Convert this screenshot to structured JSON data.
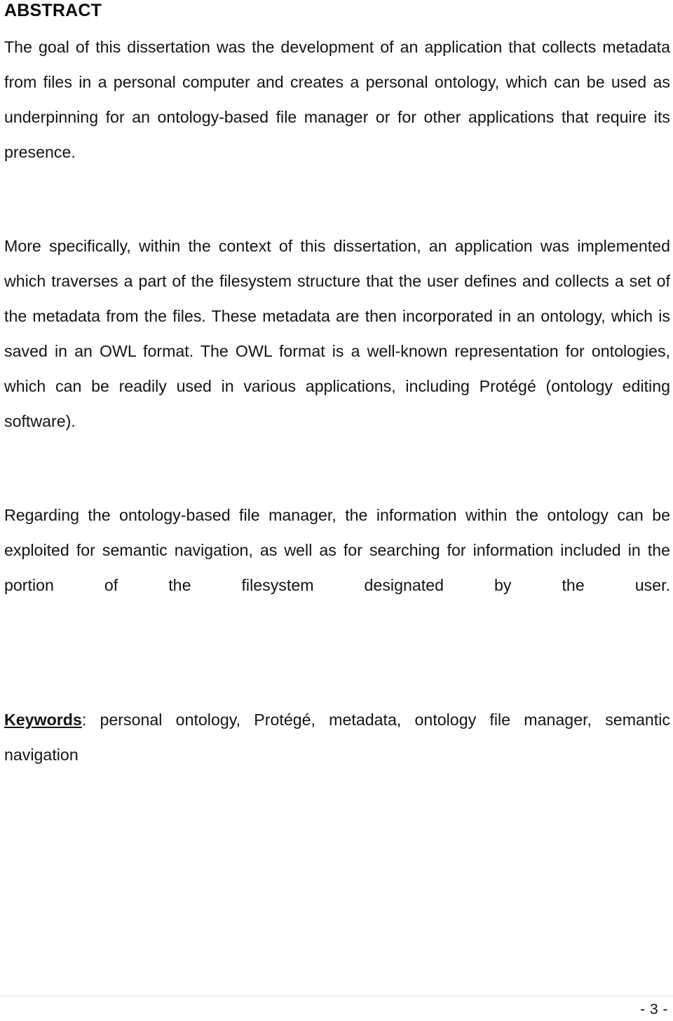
{
  "document": {
    "heading": "ABSTRACT",
    "paragraphs": [
      "The goal of this dissertation was the development of an application that collects metadata from files in a personal computer and creates a personal ontology, which can be used as underpinning for an ontology-based file manager or for other applications that require its presence.",
      "More specifically, within the context of this dissertation, an application was implemented which traverses a part of the filesystem structure that the user defines and collects a set of the metadata from the files. These metadata are then incorporated in an ontology, which is saved in an OWL format. The OWL format is a well-known representation for ontologies, which can be readily used in various applications, including Protégé (ontology editing software).",
      "Regarding the ontology-based file manager, the information within the ontology can be exploited for semantic navigation, as well as for searching for information included in the portion of the filesystem designated by the user."
    ],
    "keywords": {
      "label": "Keywords",
      "separator": ": ",
      "terms": "personal ontology, Protégé, metadata, ontology file manager, semantic navigation"
    }
  },
  "footer": {
    "page_number": "- 3 -"
  }
}
